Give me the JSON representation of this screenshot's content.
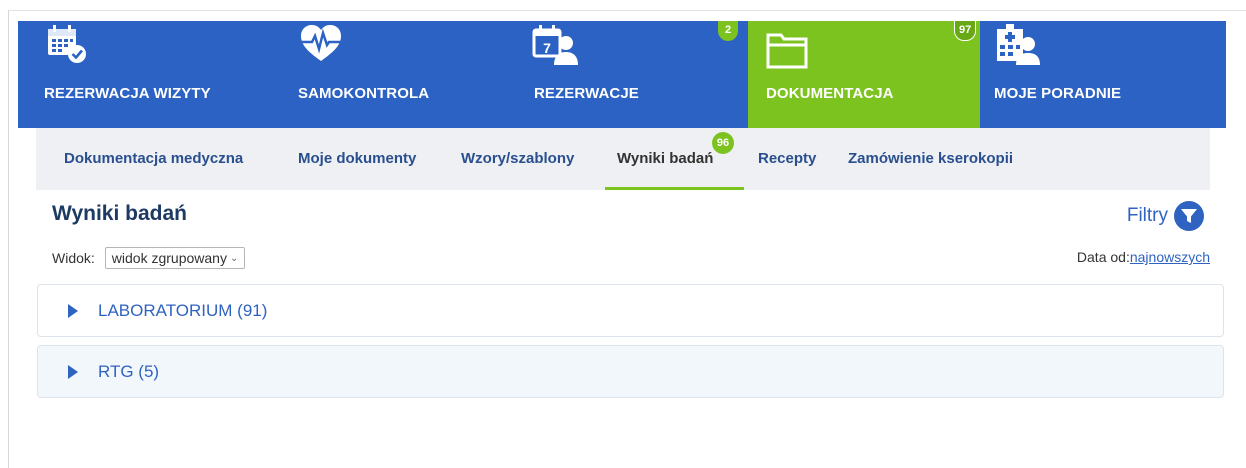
{
  "topnav": {
    "items": [
      {
        "label": "REZERWACJA WIZYTY",
        "icon": "calendar-check-icon",
        "active": false,
        "badge": ""
      },
      {
        "label": "SAMOKONTROLA",
        "icon": "heart-pulse-icon",
        "active": false,
        "badge": ""
      },
      {
        "label": "REZERWACJE",
        "icon": "calendar-person-icon",
        "active": false,
        "badge": "2"
      },
      {
        "label": "DOKUMENTACJA",
        "icon": "folder-icon",
        "active": true,
        "badge": "97"
      },
      {
        "label": "MOJE PORADNIE",
        "icon": "clinic-person-icon",
        "active": false,
        "badge": ""
      }
    ],
    "calendar_day": "7"
  },
  "subnav": {
    "tabs": [
      {
        "label": "Dokumentacja medyczna"
      },
      {
        "label": "Moje dokumenty"
      },
      {
        "label": "Wzory/szablony"
      },
      {
        "label": "Wyniki badań",
        "active": true,
        "badge": "96"
      },
      {
        "label": "Recepty"
      },
      {
        "label": "Zamówienie kserokopii"
      }
    ]
  },
  "page": {
    "title": "Wyniki badań",
    "filters_label": "Filtry",
    "view_label": "Widok:",
    "view_value": "widok zgrupowany",
    "date_label": "Data od:",
    "date_link": "najnowszych"
  },
  "groups": [
    {
      "label": "LABORATORIUM (91)"
    },
    {
      "label": "RTG (5)"
    }
  ],
  "colors": {
    "nav_blue": "#2c62c4",
    "accent_green": "#7dc31f",
    "link_blue": "#2f63c1",
    "title_navy": "#1d3a63"
  }
}
